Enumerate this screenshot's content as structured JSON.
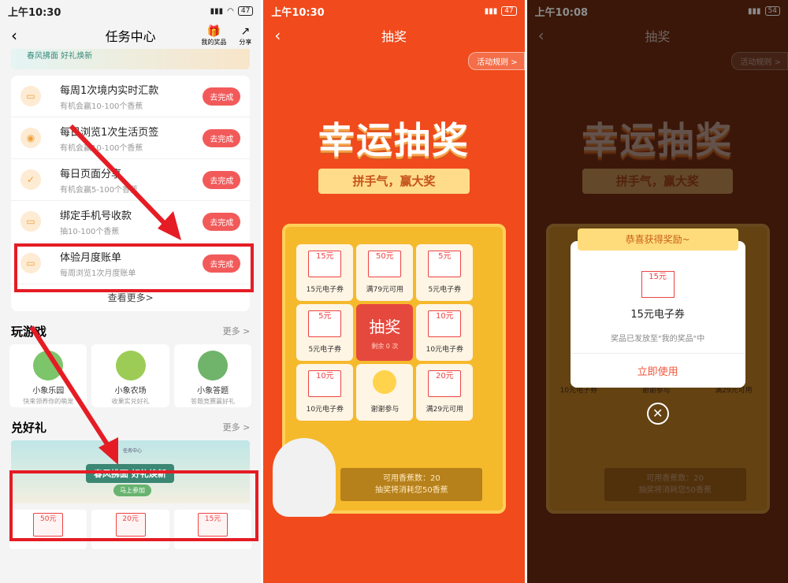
{
  "screen1": {
    "status": {
      "time": "上午10:30",
      "battery": "47"
    },
    "title": "任务中心",
    "my_prizes": "我的奖品",
    "share": "分享",
    "banner_text": "春风拂面 好礼焕新",
    "tasks": [
      {
        "title": "每周1次境内实时汇款",
        "sub": "有机会赢10-100个香蕉",
        "btn": "去完成"
      },
      {
        "title": "每日浏览1次生活页签",
        "sub": "有机会赢10-100个香蕉",
        "btn": "去完成"
      },
      {
        "title": "每日页面分享",
        "sub": "有机会赢5-100个香蕉",
        "btn": "去完成"
      },
      {
        "title": "绑定手机号收款",
        "sub": "抽10-100个香蕉",
        "btn": "去完成"
      },
      {
        "title": "体验月度账单",
        "sub": "每周浏览1次月度账单",
        "btn": "去完成"
      }
    ],
    "see_more": "查看更多>",
    "games_title": "玩游戏",
    "more": "更多 >",
    "games": [
      {
        "name": "小象乐园",
        "desc": "快来领养你的萌宠"
      },
      {
        "name": "小象农场",
        "desc": "收果实兑好礼"
      },
      {
        "name": "小象答题",
        "desc": "答题竞赛赢好礼"
      }
    ],
    "gift_title": "兑好礼",
    "gift_banner": {
      "top": "任务中心",
      "main": "春风拂面 好礼焕新",
      "btn": "马上参加"
    },
    "coupons": [
      "50元",
      "20元",
      "15元"
    ]
  },
  "screen2": {
    "status": {
      "time": "上午10:30",
      "battery": "47"
    },
    "title": "抽奖",
    "rules": "活动规则 >",
    "big_title": "幸运抽奖",
    "slogan": "拼手气，赢大奖",
    "cells": [
      {
        "coupon": "15元",
        "label": "15元电子券"
      },
      {
        "coupon": "50元",
        "label": "满79元可用"
      },
      {
        "coupon": "5元",
        "label": "5元电子券"
      },
      {
        "coupon": "5元",
        "label": "5元电子券"
      },
      {
        "coupon": "",
        "label": ""
      },
      {
        "coupon": "10元",
        "label": "10元电子券"
      },
      {
        "coupon": "10元",
        "label": "10元电子券"
      },
      {
        "coupon": "",
        "label": "谢谢参与"
      },
      {
        "coupon": "20元",
        "label": "满29元可用"
      }
    ],
    "draw": "抽奖",
    "remaining": "剩余 0 次",
    "banana_count": "可用香蕉数：20",
    "cost_note": "抽奖将消耗您50香蕉"
  },
  "screen3": {
    "status": {
      "time": "上午10:08",
      "battery": "54"
    },
    "title": "抽奖",
    "rules": "活动规则 >",
    "big_title": "幸运抽奖",
    "slogan": "拼手气，赢大奖",
    "popup_header": "恭喜获得奖励~",
    "prize_coupon": "15元",
    "prize_name": "15元电子券",
    "prize_note": "奖品已发放至\"我的奖品\"中",
    "use_now": "立即使用",
    "close": "✕",
    "bg_cells": [
      "10元电子券",
      "谢谢参与",
      "满29元可用"
    ],
    "banana_count": "可用香蕉数：20",
    "cost_note": "抽奖将消耗您50香蕉"
  }
}
